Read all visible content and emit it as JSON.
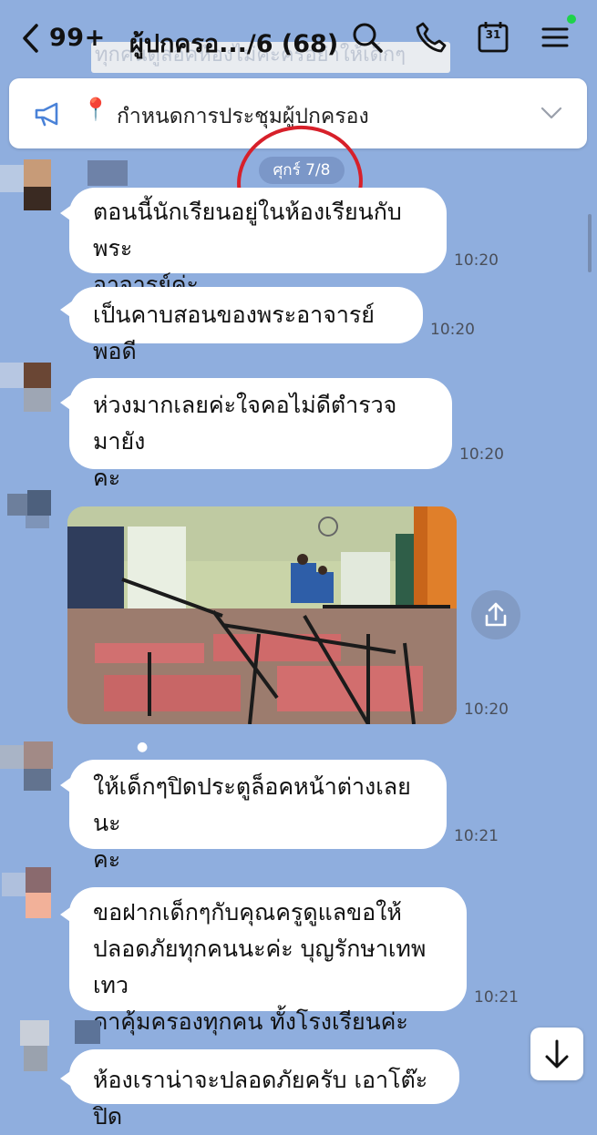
{
  "header": {
    "unread_count": "99+",
    "chat_title": "ผู้ปกครอ.../6 (68)",
    "calendar_day": "31",
    "ghost_text": "ทุกคนดูลอคห้องไม่ค่ะครอย่าให้เด็กๆ"
  },
  "announcement": {
    "pin": "📍",
    "text": "กำหนดการประชุมผู้ปกครอง"
  },
  "date_chip": "ศุกร์ 7/8",
  "messages": [
    {
      "lines": [
        "ตอนนี้นักเรียนอยู่ในห้องเรียนกับพระ",
        "อาจารย์ค่ะ"
      ],
      "time": "10:20"
    },
    {
      "lines": [
        "เป็นคาบสอนของพระอาจารย์พอดี"
      ],
      "time": "10:20"
    },
    {
      "lines": [
        "ห่วงมากเลยค่ะใจคอไม่ดีตำรวจมายัง",
        "คะ"
      ],
      "time": "10:20"
    },
    {
      "photo": "classroom-photo",
      "time": "10:20"
    },
    {
      "lines": [
        "ให้เด็กๆปิดประตูล็อคหน้าต่างเลยนะ",
        "คะ"
      ],
      "time": "10:21"
    },
    {
      "lines": [
        "ขอฝากเด็กๆกับคุณครูดูแลขอให้",
        "ปลอดภัยทุกคนนะค่ะ บุญรักษาเทพเทว",
        "ดาคุ้มครองทุกคน ทั้งโรงเรียนค่ะ"
      ],
      "time": "10:21"
    },
    {
      "lines": [
        "ห้องเราน่าจะปลอดภัยครับ เอาโต๊ะปิด"
      ]
    }
  ],
  "icons": {
    "back": "chevron-left-icon",
    "search": "search-icon",
    "call": "phone-icon",
    "calendar": "calendar-icon",
    "menu": "hamburger-menu-icon",
    "announce": "megaphone-icon",
    "expand": "chevron-down-icon",
    "share": "share-icon",
    "scroll": "arrow-down-icon"
  },
  "colors": {
    "background": "#8faede",
    "bubble": "#ffffff",
    "online": "#1ed34a",
    "annotation_circle": "#d7202a"
  }
}
